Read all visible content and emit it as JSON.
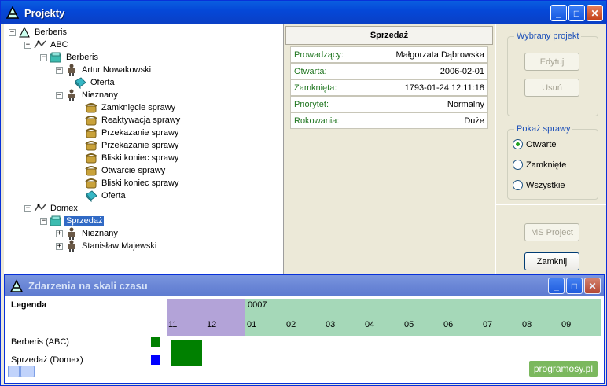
{
  "window": {
    "title": "Projekty"
  },
  "tree": {
    "nodes": [
      {
        "label": "Berberis"
      },
      {
        "label": "ABC"
      },
      {
        "label": "Berberis"
      },
      {
        "label": "Artur Nowakowski"
      },
      {
        "label": "Oferta"
      },
      {
        "label": "Nieznany"
      },
      {
        "label": "Zamknięcie sprawy"
      },
      {
        "label": "Reaktywacja sprawy"
      },
      {
        "label": "Przekazanie sprawy"
      },
      {
        "label": "Przekazanie sprawy"
      },
      {
        "label": "Bliski koniec sprawy"
      },
      {
        "label": "Otwarcie sprawy"
      },
      {
        "label": "Bliski koniec sprawy"
      },
      {
        "label": "Oferta"
      },
      {
        "label": "Domex"
      },
      {
        "label": "Sprzedaż"
      },
      {
        "label": "Nieznany"
      },
      {
        "label": "Stanisław Majewski"
      }
    ]
  },
  "details": {
    "header": "Sprzedaż",
    "rows": [
      {
        "key": "Prowadzący:",
        "value": "Małgorzata Dąbrowska"
      },
      {
        "key": "Otwarta:",
        "value": "2006-02-01"
      },
      {
        "key": "Zamknięta:",
        "value": "1793-01-24 12:11:18"
      },
      {
        "key": "Priorytet:",
        "value": "Normalny"
      },
      {
        "key": "Rokowania:",
        "value": "Duże"
      }
    ]
  },
  "project_group": {
    "title": "Wybrany projekt",
    "edit_label": "Edytuj",
    "delete_label": "Usuń"
  },
  "show_group": {
    "title": "Pokaż sprawy",
    "options": [
      {
        "label": "Otwarte",
        "selected": true
      },
      {
        "label": "Zamknięte",
        "selected": false
      },
      {
        "label": "Wszystkie",
        "selected": false
      }
    ]
  },
  "buttons": {
    "ms_project": "MS Project",
    "close": "Zamknij"
  },
  "timeline": {
    "title": "Zdarzenia na skali czasu",
    "legend_title": "Legenda",
    "year_label": "0007",
    "prev_months": [
      "11",
      "12"
    ],
    "months": [
      "01",
      "02",
      "03",
      "04",
      "05",
      "06",
      "07",
      "08",
      "09"
    ],
    "rows": [
      {
        "label": "Berberis (ABC)",
        "color": "#008000"
      },
      {
        "label": "Sprzedaż (Domex)",
        "color": "#0000ff"
      }
    ]
  },
  "watermark": "programosy.pl"
}
